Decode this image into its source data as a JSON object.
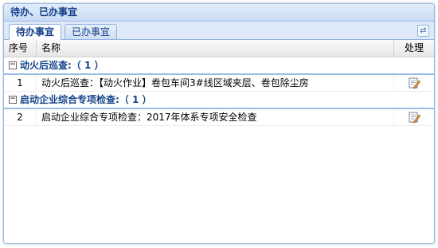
{
  "panel": {
    "title": "待办、已办事宜"
  },
  "tabs": [
    {
      "label": "待办事宜",
      "active": true
    },
    {
      "label": "已办事宜",
      "active": false
    }
  ],
  "toolbar": {
    "refresh_icon": "refresh-icon"
  },
  "columns": {
    "no": "序号",
    "name": "名称",
    "action": "处理"
  },
  "groups": [
    {
      "title": "动火后巡查:（ 1 ）",
      "rows": [
        {
          "no": "1",
          "name": "动火后巡查：【动火作业】卷包车间3#线区域夹层、卷包除尘房",
          "action_icon": "edit-icon"
        }
      ]
    },
    {
      "title": "启动企业综合专项检查:（ 1 ）",
      "rows": [
        {
          "no": "2",
          "name": "启动企业综合专项检查：2017年体系专项安全检查",
          "action_icon": "edit-icon"
        }
      ]
    }
  ],
  "colors": {
    "header_text": "#15428b",
    "border": "#99bbe8"
  }
}
